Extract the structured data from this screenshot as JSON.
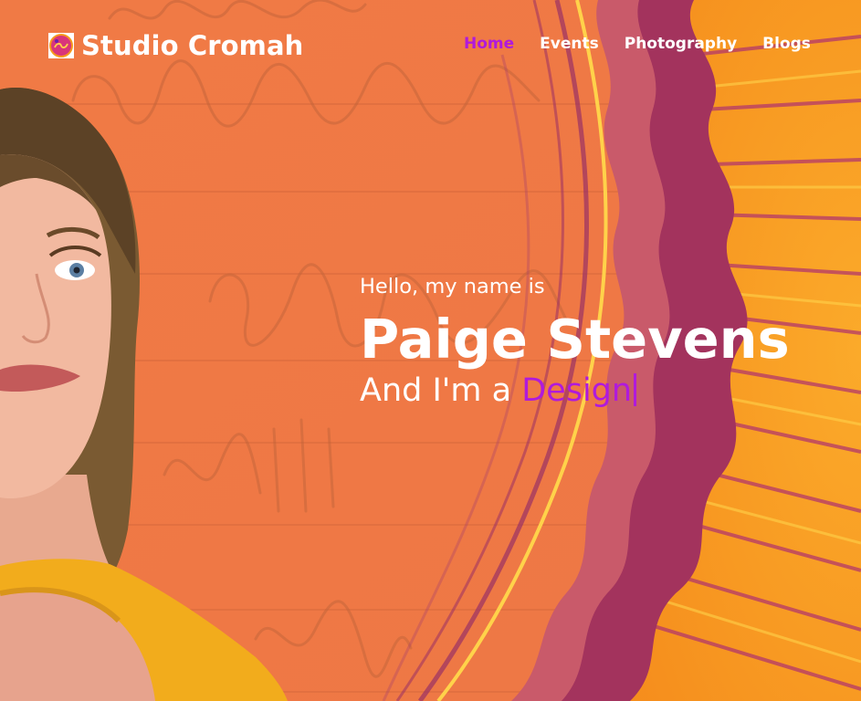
{
  "brand": {
    "name": "Studio Cromah",
    "logo_icon": "studio-logo-icon"
  },
  "nav": {
    "items": [
      {
        "label": "Home",
        "active": true
      },
      {
        "label": "Events",
        "active": false
      },
      {
        "label": "Photography",
        "active": false
      },
      {
        "label": "Blogs",
        "active": false
      }
    ]
  },
  "hero": {
    "intro": "Hello, my name is",
    "name": "Paige Stevens",
    "role_prefix": "And I'm a ",
    "role_typed": "Design"
  },
  "colors": {
    "accent": "#b01adc",
    "text": "#ffffff",
    "background_orange": "#f07a45",
    "sun_orange": "#f7991d",
    "wave_plum": "#a3335d",
    "wave_rose": "#c95a6a",
    "stripe_yellow": "#ffd24a"
  }
}
